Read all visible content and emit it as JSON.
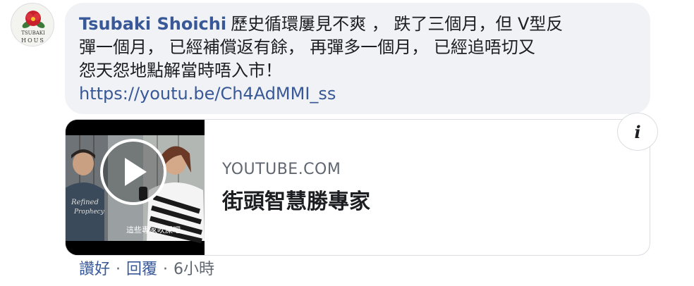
{
  "comment": {
    "author": "Tsubaki Shoichi",
    "avatar_text_top": "TSUBAKI",
    "avatar_text_bottom": "HOUS",
    "lines": [
      "歷史循環屢見不爽 ， 跌了三個月，但 V型反",
      "彈一個月， 已經補償返有餘， 再彈多一個月， 已經追唔切又",
      "怨天怨地點解當時唔入市！"
    ],
    "link": "https://youtu.be/Ch4AdMMI_ss"
  },
  "preview": {
    "domain": "YOUTUBE.COM",
    "title": "街頭智慧勝專家",
    "thumbnail_caption": "這些專家吹屎吧",
    "shirt_text_1": "Refined",
    "shirt_text_2": "Prophecy",
    "info_icon": "i"
  },
  "actions": {
    "like": "讚好",
    "reply": "回覆",
    "separator": "·",
    "time": "6小時"
  },
  "colors": {
    "link": "#385898",
    "bubble_bg": "#f0f2f5",
    "secondary_text": "#606770"
  }
}
